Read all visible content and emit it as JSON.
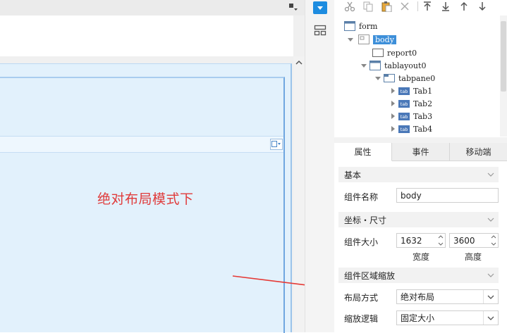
{
  "canvas": {
    "annotation": "绝对布局模式下"
  },
  "toolbar": {
    "icons": [
      "cut-icon",
      "copy-icon",
      "paste-icon",
      "delete-icon",
      "move-top-icon",
      "move-bottom-icon",
      "move-up-icon",
      "move-down-icon"
    ]
  },
  "tree": {
    "form": "form",
    "body": "body",
    "report0": "report0",
    "tablayout0": "tablayout0",
    "tabpane0": "tabpane0",
    "tab1": "Tab1",
    "tab2": "Tab2",
    "tab3": "Tab3",
    "tab4": "Tab4",
    "tab_badge": "tab"
  },
  "tabs": {
    "attributes": "属性",
    "events": "事件",
    "mobile": "移动端"
  },
  "sections": {
    "basic": "基本",
    "coord_size": "坐标・尺寸",
    "zoom": "组件区域缩放"
  },
  "props": {
    "name_label": "组件名称",
    "name_value": "body",
    "size_label": "组件大小",
    "width_value": "1632",
    "height_value": "3600",
    "width_label": "宽度",
    "height_label": "高度",
    "layout_label": "布局方式",
    "layout_value": "绝对布局",
    "scale_label": "缩放逻辑",
    "scale_value": "固定大小"
  },
  "colors": {
    "accent": "#1d8ce0",
    "canvas_bg": "#e2f1fc",
    "annotation": "#e03a3a",
    "tree_selected": "#3d8fd9"
  }
}
